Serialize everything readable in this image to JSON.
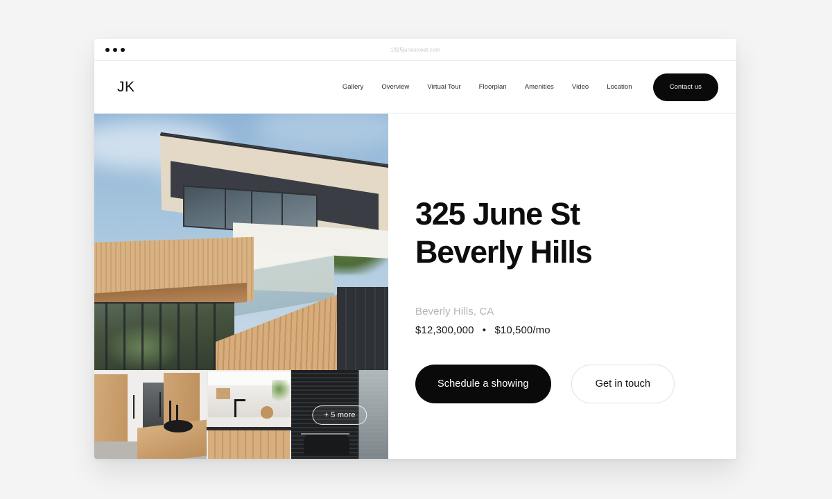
{
  "browser": {
    "url": "1325junestreet.com",
    "traffic_lights": [
      "close-dot",
      "minimize-dot",
      "maximize-dot"
    ]
  },
  "header": {
    "logo": "JK",
    "nav_items": [
      {
        "label": "Gallery"
      },
      {
        "label": "Overview"
      },
      {
        "label": "Virtual Tour"
      },
      {
        "label": "Floorplan"
      },
      {
        "label": "Amenities"
      },
      {
        "label": "Video"
      },
      {
        "label": "Location"
      }
    ],
    "contact_button": "Contact us"
  },
  "gallery": {
    "hero_alt": "modern-house-exterior-photo",
    "thumbnails": [
      {
        "alt": "interior-hallway-kitchen-island-photo"
      },
      {
        "alt": "kitchen-counter-marble-splashback-photo"
      },
      {
        "alt": "dark-living-room-glass-door-photo"
      }
    ],
    "more_badge": "+ 5 more"
  },
  "listing": {
    "title_line1": "325 June St",
    "title_line2": "Beverly Hills",
    "locality": "Beverly Hills, CA",
    "sale_price": "$12,300,000",
    "price_separator": "•",
    "rent_price": "$10,500/mo",
    "primary_cta": "Schedule a showing",
    "secondary_cta": "Get in touch"
  },
  "colors": {
    "accent": "#0a0a0a",
    "page_background": "#f4f4f4",
    "card_background": "#ffffff",
    "muted_text": "#b4b4b4",
    "border": "#e2e2e2"
  }
}
